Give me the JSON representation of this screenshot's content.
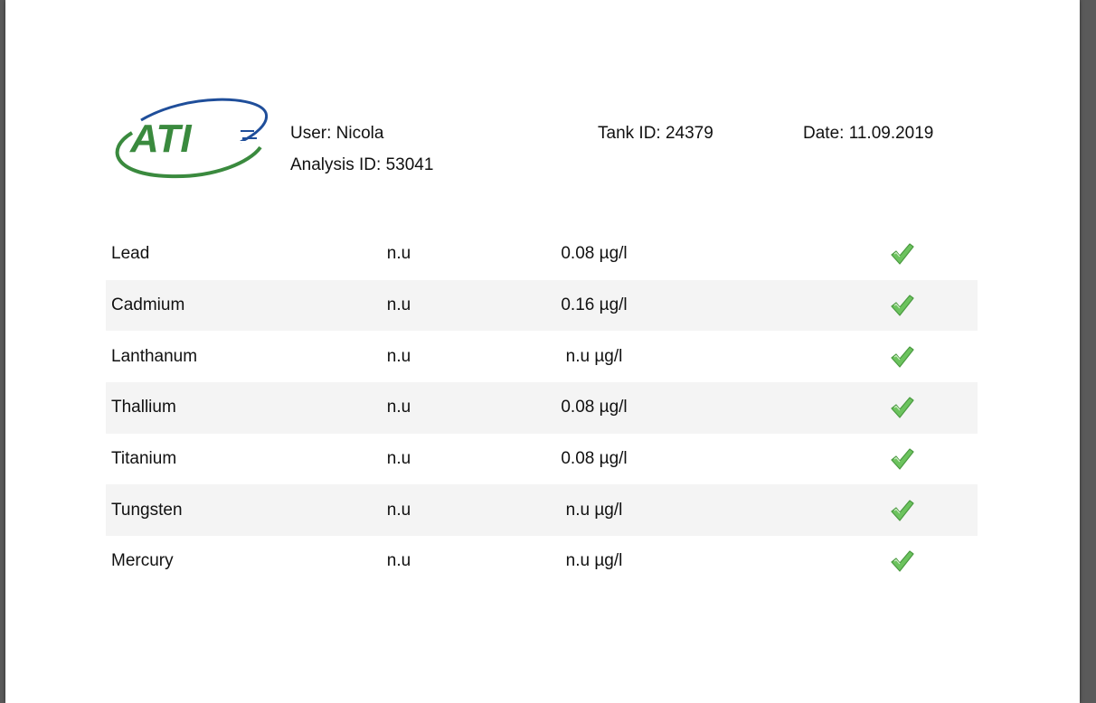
{
  "header": {
    "logo_text": "ATI",
    "user": "User: Nicola",
    "analysis_id": "Analysis ID: 53041",
    "tank_id": "Tank ID: 24379",
    "date": "Date: 11.09.2019"
  },
  "results": [
    {
      "element": "Lead",
      "value1": "n.u",
      "value2": "0.08 µg/l",
      "status_icon": "check-icon"
    },
    {
      "element": "Cadmium",
      "value1": "n.u",
      "value2": "0.16 µg/l",
      "status_icon": "check-icon"
    },
    {
      "element": "Lanthanum",
      "value1": "n.u",
      "value2": "n.u µg/l",
      "status_icon": "check-icon"
    },
    {
      "element": "Thallium",
      "value1": "n.u",
      "value2": "0.08 µg/l",
      "status_icon": "check-icon"
    },
    {
      "element": "Titanium",
      "value1": "n.u",
      "value2": "0.08 µg/l",
      "status_icon": "check-icon"
    },
    {
      "element": "Tungsten",
      "value1": "n.u",
      "value2": "n.u µg/l",
      "status_icon": "check-icon"
    },
    {
      "element": "Mercury",
      "value1": "n.u",
      "value2": "n.u µg/l",
      "status_icon": "check-icon"
    }
  ],
  "colors": {
    "logo_blue": "#1f4e9a",
    "logo_green": "#3a8a3e",
    "check_green": "#6cc35e",
    "row_shade": "#f4f4f4"
  }
}
